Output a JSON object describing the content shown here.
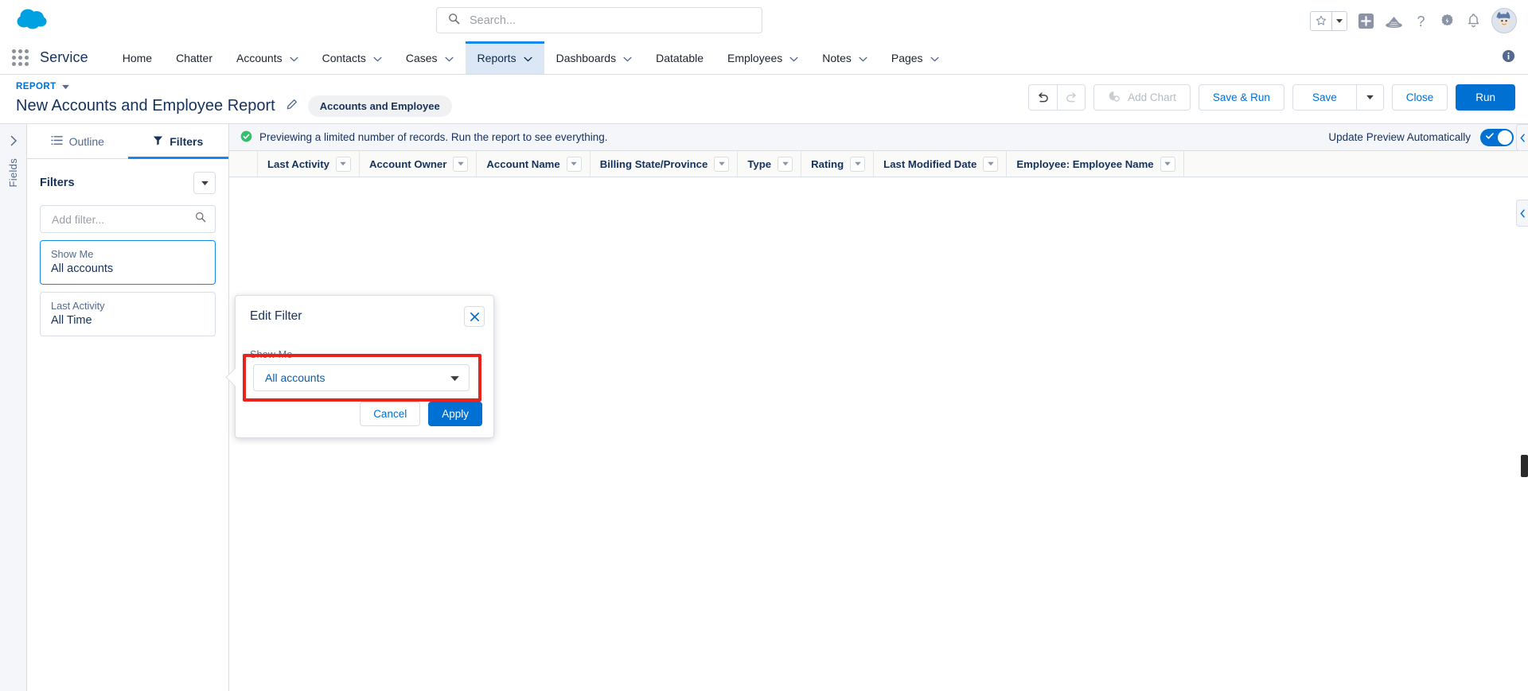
{
  "global": {
    "logo_icon": "salesforce-cloud-logo",
    "search": {
      "placeholder": "Search...",
      "icon": "search-icon"
    },
    "icons": {
      "favorites": "star-icon",
      "favorites_caret": "chevron-down-icon",
      "add": "plus-icon",
      "trailhead": "trailhead-icon",
      "help": "question-mark-icon",
      "setup": "gear-icon",
      "notifications": "bell-icon",
      "avatar": "user-avatar"
    }
  },
  "appnav": {
    "waffle_icon": "app-launcher-icon",
    "app_name": "Service",
    "info_icon": "info-icon",
    "items": [
      {
        "label": "Home",
        "caret": false,
        "active": false
      },
      {
        "label": "Chatter",
        "caret": false,
        "active": false
      },
      {
        "label": "Accounts",
        "caret": true,
        "active": false
      },
      {
        "label": "Contacts",
        "caret": true,
        "active": false
      },
      {
        "label": "Cases",
        "caret": true,
        "active": false
      },
      {
        "label": "Reports",
        "caret": true,
        "active": true
      },
      {
        "label": "Dashboards",
        "caret": true,
        "active": false
      },
      {
        "label": "Datatable",
        "caret": false,
        "active": false
      },
      {
        "label": "Employees",
        "caret": true,
        "active": false
      },
      {
        "label": "Notes",
        "caret": true,
        "active": false
      },
      {
        "label": "Pages",
        "caret": true,
        "active": false
      }
    ]
  },
  "report_header": {
    "breadcrumb": "REPORT",
    "breadcrumb_caret": "caret-down-icon",
    "title": "New Accounts and Employee Report",
    "edit_icon": "pencil-icon",
    "badge": "Accounts and Employee",
    "undo_icon": "undo-icon",
    "redo_icon": "redo-icon",
    "add_chart": "Add Chart",
    "add_chart_icon": "chart-icon",
    "save_and_run": "Save & Run",
    "save": "Save",
    "save_caret": "caret-down-icon",
    "close": "Close",
    "run": "Run"
  },
  "left_panel": {
    "rail_label": "Fields",
    "rail_expand_icon": "chevron-right-icon",
    "tabs": [
      {
        "label": "Outline",
        "icon": "outline-icon",
        "active": false
      },
      {
        "label": "Filters",
        "icon": "filter-funnel-icon",
        "active": true
      }
    ],
    "filters_title": "Filters",
    "filters_menu_icon": "caret-down-icon",
    "add_filter_placeholder": "Add filter...",
    "add_filter_icon": "search-icon",
    "filter_cards": [
      {
        "label": "Show Me",
        "value": "All accounts",
        "selected": true
      },
      {
        "label": "Last Activity",
        "value": "All Time",
        "selected": false
      }
    ]
  },
  "preview": {
    "status_icon": "success-check-icon",
    "status_text": "Previewing a limited number of records. Run the report to see everything.",
    "toggle_label": "Update Preview Automatically",
    "toggle_on": true,
    "toggle_check_icon": "check-icon",
    "columns": [
      "Last Activity",
      "Account Owner",
      "Account Name",
      "Billing State/Province",
      "Type",
      "Rating",
      "Last Modified Date",
      "Employee: Employee Name"
    ],
    "column_caret_icon": "caret-down-icon"
  },
  "popover": {
    "title": "Edit Filter",
    "close_icon": "close-x-icon",
    "field_label": "Show Me",
    "field_value": "All accounts",
    "field_caret_icon": "caret-down-icon",
    "cancel": "Cancel",
    "apply": "Apply",
    "highlight_color": "#e8221d"
  }
}
